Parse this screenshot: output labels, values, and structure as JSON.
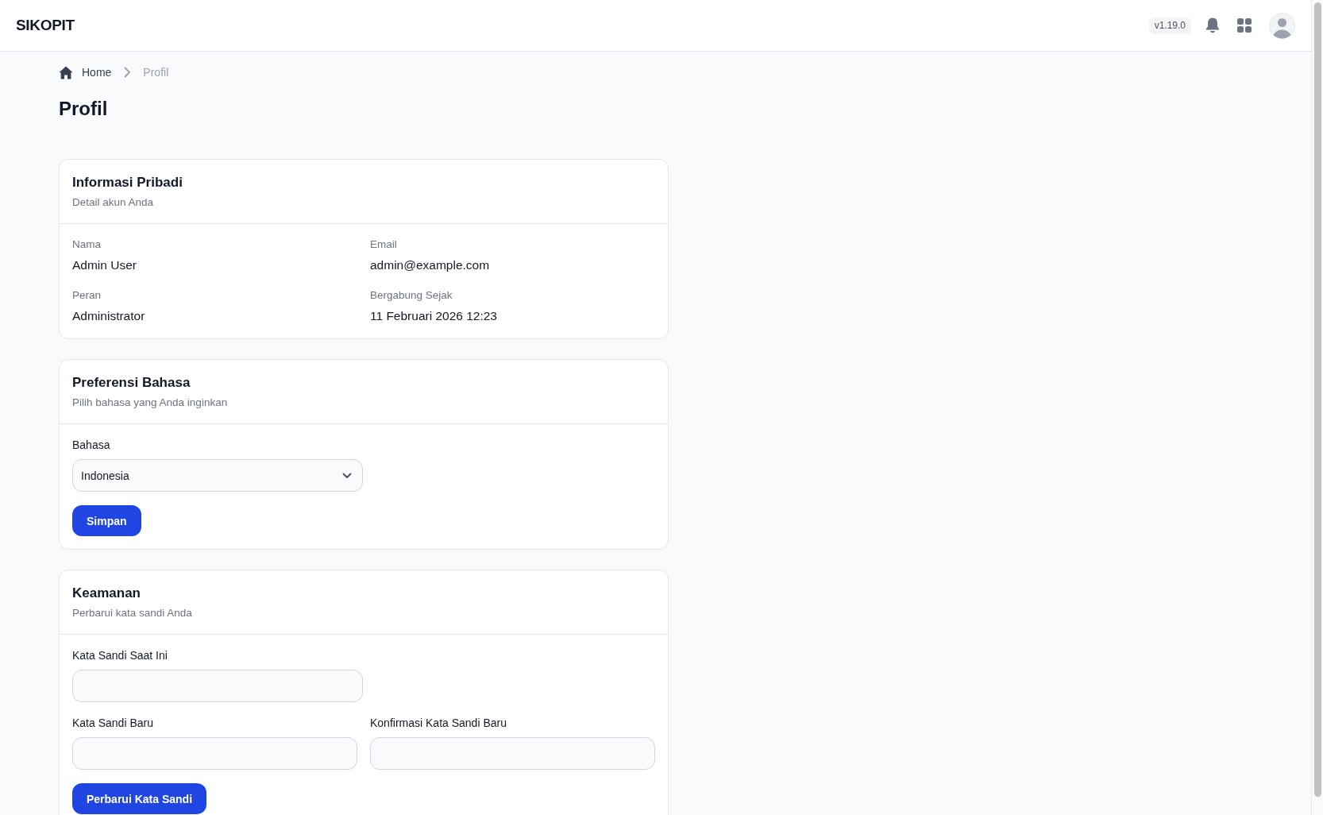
{
  "header": {
    "logo": "SIKOPIT",
    "version": "v1.19.0"
  },
  "breadcrumb": [
    {
      "label": "Home",
      "kind": "home"
    },
    {
      "label": "Profil",
      "kind": "current"
    }
  ],
  "page_title": "Profil",
  "personal_info": {
    "title": "Informasi Pribadi",
    "subtitle": "Detail akun Anda",
    "fields": [
      {
        "label": "Nama",
        "value": "Admin User"
      },
      {
        "label": "Email",
        "value": "admin@example.com"
      },
      {
        "label": "Peran",
        "value": "Administrator"
      },
      {
        "label": "Bergabung Sejak",
        "value": "11 Februari 2026 12:23"
      }
    ]
  },
  "language": {
    "title": "Preferensi Bahasa",
    "subtitle": "Pilih bahasa yang Anda inginkan",
    "field": {
      "label": "Bahasa",
      "value": "Indonesia"
    },
    "button": "Simpan"
  },
  "security": {
    "title": "Keamanan",
    "subtitle": "Perbarui kata sandi Anda",
    "fields": [
      {
        "label": "Kata Sandi Saat Ini"
      },
      {
        "label": "Kata Sandi Baru"
      },
      {
        "label": "Konfirmasi Kata Sandi Baru"
      }
    ],
    "button": "Perbarui Kata Sandi"
  }
}
